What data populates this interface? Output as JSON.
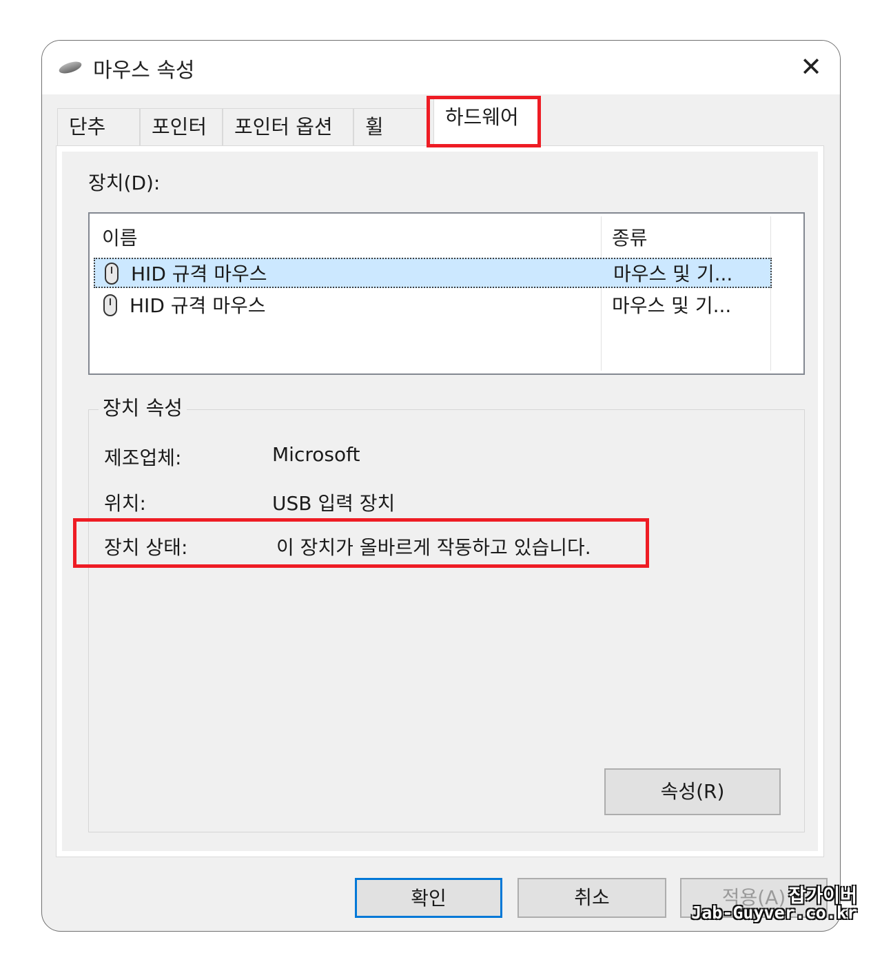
{
  "window": {
    "title": "마우스 속성",
    "icon": "mouse-icon"
  },
  "tabs": [
    {
      "label": "단추"
    },
    {
      "label": "포인터"
    },
    {
      "label": "포인터 옵션"
    },
    {
      "label": "휠"
    },
    {
      "label": "하드웨어",
      "active": true
    }
  ],
  "devices": {
    "label": "장치(D):",
    "columns": [
      "이름",
      "종류"
    ],
    "rows": [
      {
        "name": "HID 규격 마우스",
        "type": "마우스 및 기...",
        "selected": true
      },
      {
        "name": "HID 규격 마우스",
        "type": "마우스 및 기...",
        "selected": false
      }
    ]
  },
  "properties": {
    "group_title": "장치 속성",
    "manufacturer_label": "제조업체:",
    "manufacturer": "Microsoft",
    "location_label": "위치:",
    "location": "USB 입력 장치",
    "status_label": "장치 상태:",
    "status": "이 장치가 올바르게 작동하고 있습니다.",
    "properties_button": "속성(R)"
  },
  "buttons": {
    "ok": "확인",
    "cancel": "취소",
    "apply": "적용(A)"
  },
  "watermark": {
    "line1": "잡가이버",
    "line2": "Jab-Guyver.co.kr"
  },
  "colors": {
    "highlight": "#ee1c24",
    "selection": "#cce8ff",
    "default_button_border": "#0078d7"
  }
}
